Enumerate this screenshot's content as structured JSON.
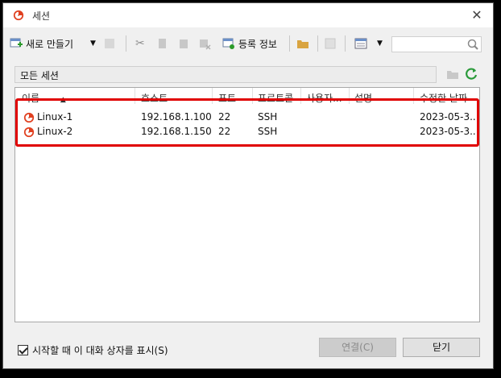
{
  "window": {
    "title": "세션"
  },
  "toolbar": {
    "new_label": "새로 만들기",
    "properties_label": "등록 정보"
  },
  "search": {
    "placeholder": ""
  },
  "path": {
    "label": "모든 세션"
  },
  "columns": [
    "이름",
    "호스트",
    "포트",
    "프로토콜",
    "사용자...",
    "설명",
    "수정한 날짜"
  ],
  "sessions": [
    {
      "name": "Linux-1",
      "host": "192.168.1.100",
      "port": "22",
      "protocol": "SSH",
      "user": "",
      "desc": "",
      "modified": "2023-05-3..."
    },
    {
      "name": "Linux-2",
      "host": "192.168.1.150",
      "port": "22",
      "protocol": "SSH",
      "user": "",
      "desc": "",
      "modified": "2023-05-3..."
    }
  ],
  "footer": {
    "show_on_startup": "시작할 때 이 대화 상자를 표시(S)",
    "connect": "연결(C)",
    "close": "닫기"
  },
  "colors": {
    "selection_border": "#e00000",
    "accent": "#e04020"
  }
}
